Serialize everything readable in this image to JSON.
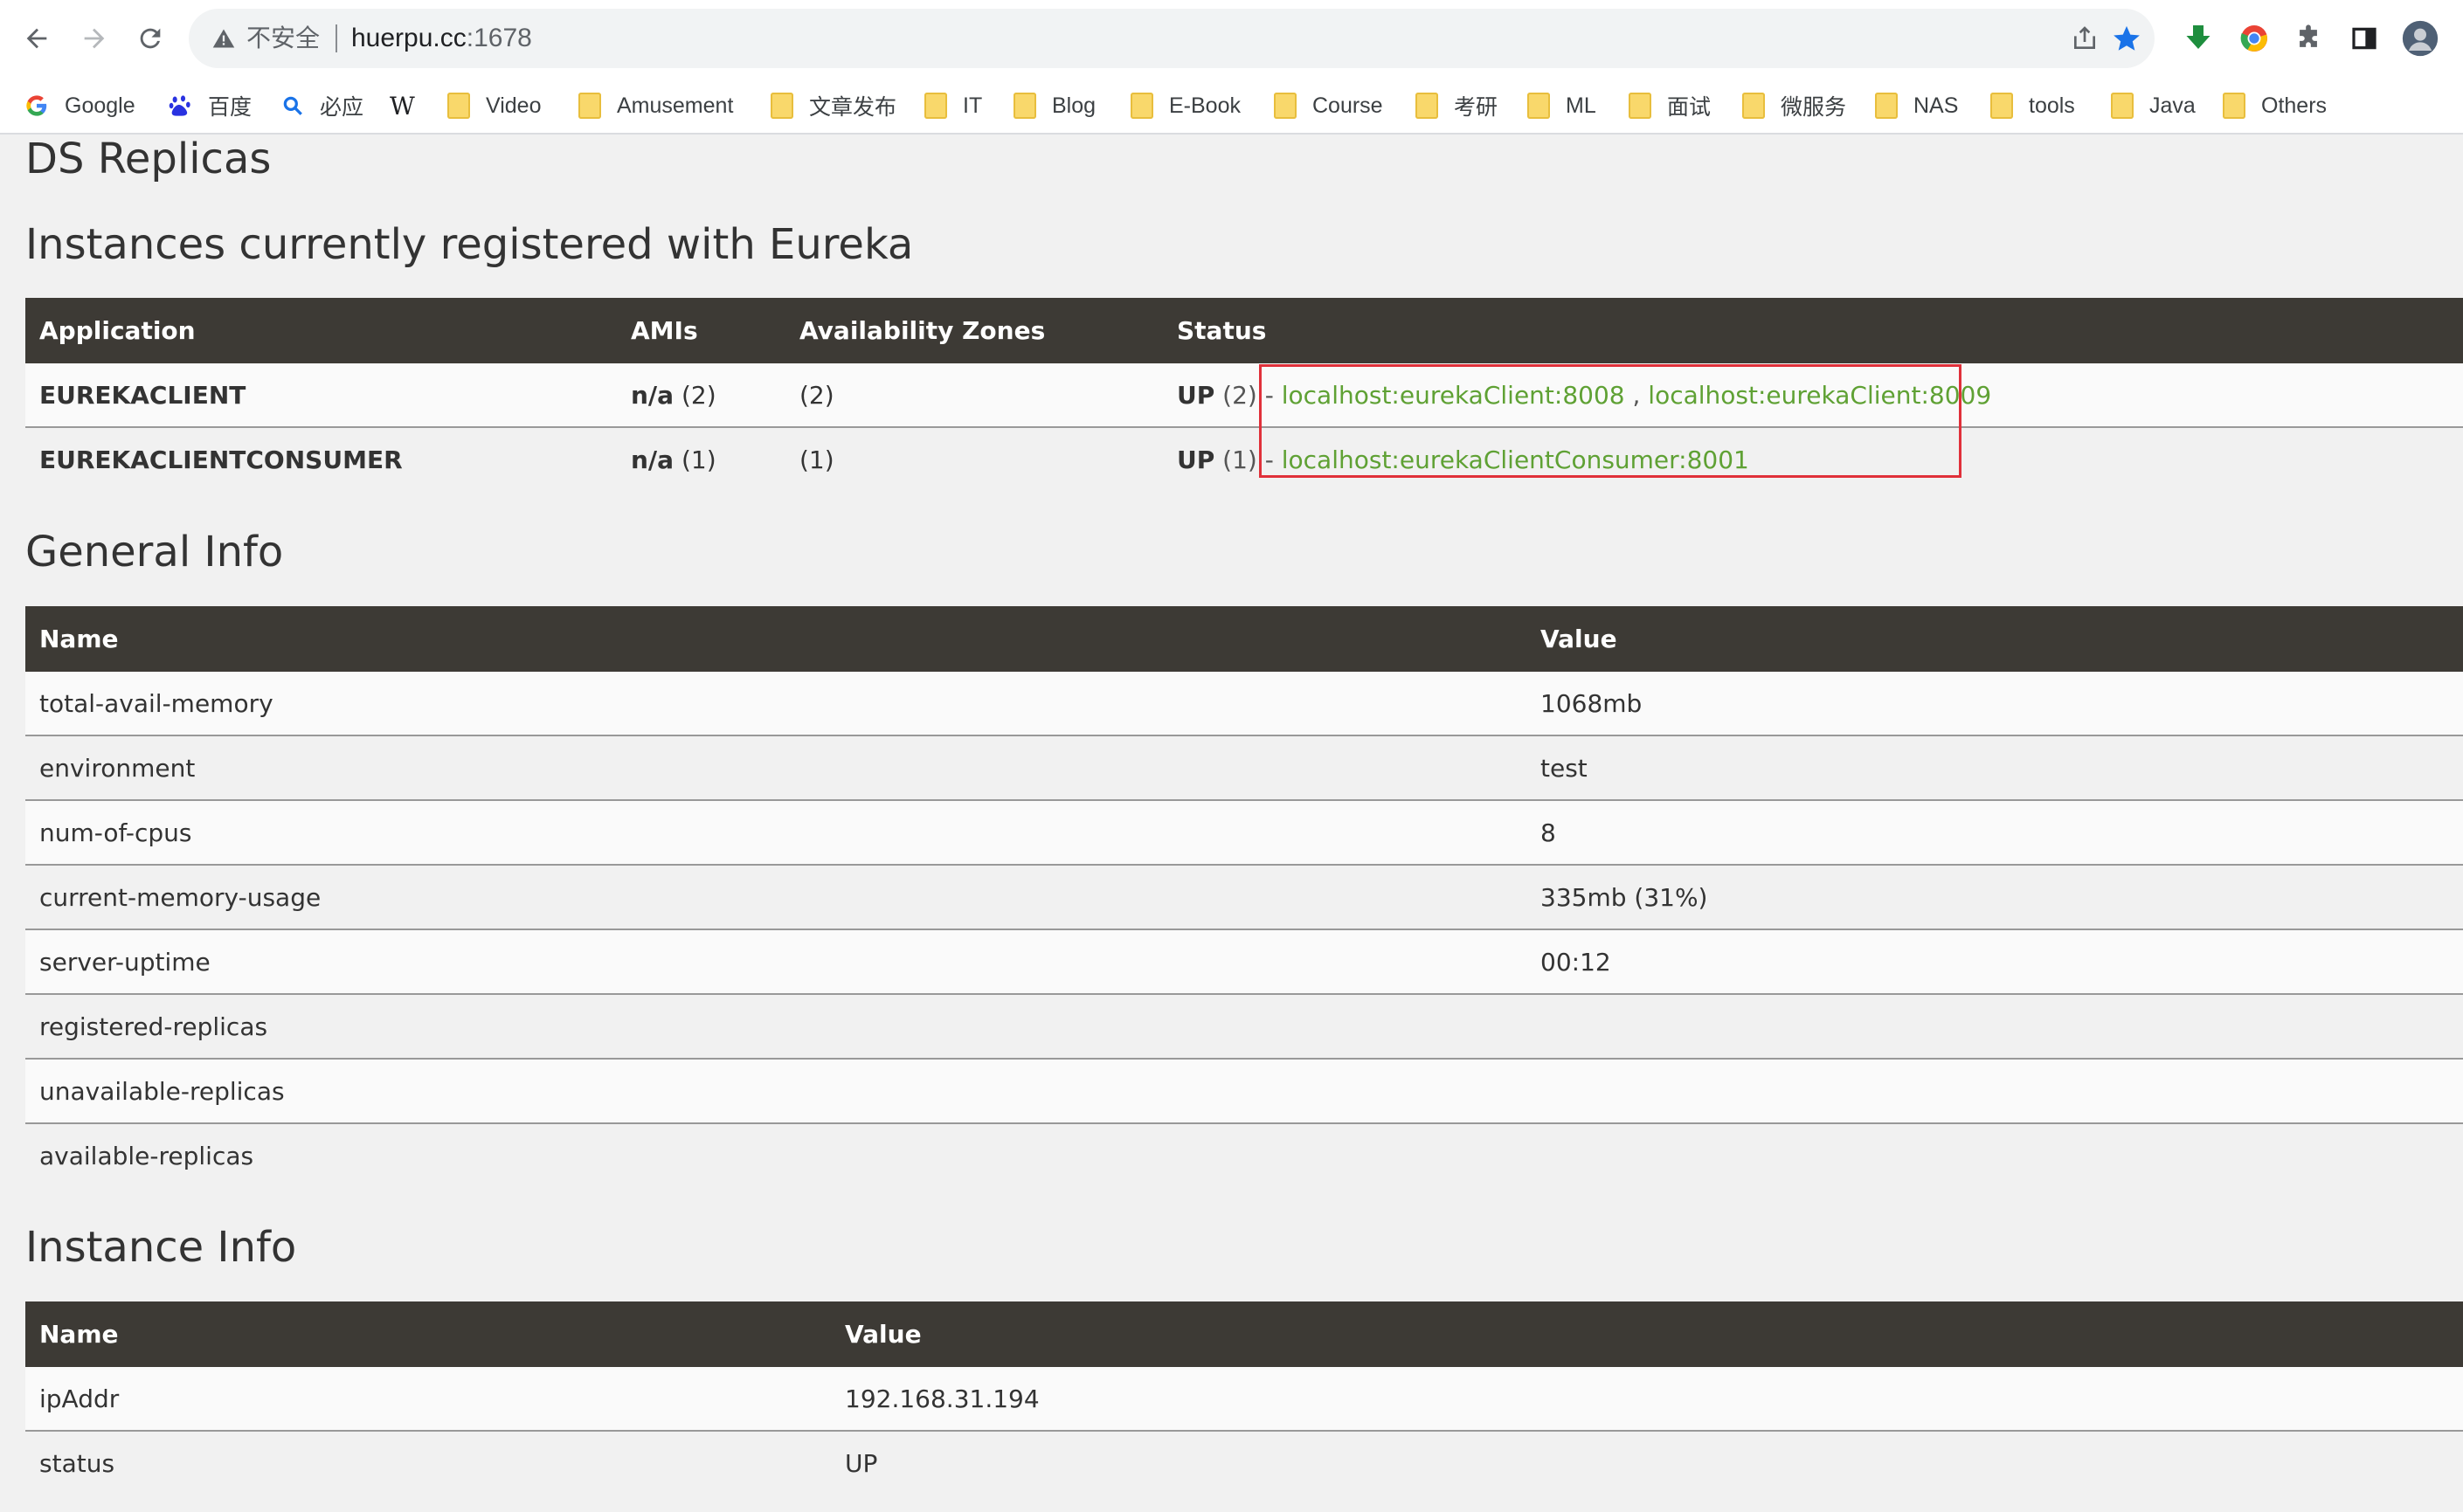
{
  "browser": {
    "insecure_label": "不安全",
    "url_host": "huerpu.cc",
    "url_port": ":1678",
    "bookmarks": [
      {
        "label": "Google",
        "icon": "google-icon"
      },
      {
        "label": "百度",
        "icon": "baidu-icon"
      },
      {
        "label": "必应",
        "icon": "bing-icon"
      },
      {
        "label": "",
        "icon": "wikipedia-icon"
      },
      {
        "label": "Video",
        "icon": "folder-icon"
      },
      {
        "label": "Amusement",
        "icon": "folder-icon"
      },
      {
        "label": "文章发布",
        "icon": "folder-icon"
      },
      {
        "label": "IT",
        "icon": "folder-icon"
      },
      {
        "label": "Blog",
        "icon": "folder-icon"
      },
      {
        "label": "E-Book",
        "icon": "folder-icon"
      },
      {
        "label": "Course",
        "icon": "folder-icon"
      },
      {
        "label": "考研",
        "icon": "folder-icon"
      },
      {
        "label": "ML",
        "icon": "folder-icon"
      },
      {
        "label": "面试",
        "icon": "folder-icon"
      },
      {
        "label": "微服务",
        "icon": "folder-icon"
      },
      {
        "label": "NAS",
        "icon": "folder-icon"
      },
      {
        "label": "tools",
        "icon": "folder-icon"
      },
      {
        "label": "Java",
        "icon": "folder-icon"
      },
      {
        "label": "Others",
        "icon": "folder-icon"
      }
    ],
    "wiki_glyph": "W"
  },
  "page": {
    "ds_replicas_title": "DS Replicas",
    "instances_title": "Instances currently registered with Eureka",
    "instances_table": {
      "headers": [
        "Application",
        "AMIs",
        "Availability Zones",
        "Status"
      ],
      "rows": [
        {
          "application": "EUREKACLIENT",
          "amis_bold": "n/a",
          "amis_count": " (2)",
          "zones": "(2)",
          "status_bold": "UP",
          "status_count": " (2) - ",
          "links": [
            "localhost:eurekaClient:8008",
            "localhost:eurekaClient:8009"
          ],
          "link_separator": " , "
        },
        {
          "application": "EUREKACLIENTCONSUMER",
          "amis_bold": "n/a",
          "amis_count": " (1)",
          "zones": "(1)",
          "status_bold": "UP",
          "status_count": " (1) - ",
          "links": [
            "localhost:eurekaClientConsumer:8001"
          ]
        }
      ]
    },
    "general_title": "General Info",
    "general_table": {
      "headers": [
        "Name",
        "Value"
      ],
      "rows": [
        {
          "name": "total-avail-memory",
          "value": "1068mb"
        },
        {
          "name": "environment",
          "value": "test"
        },
        {
          "name": "num-of-cpus",
          "value": "8"
        },
        {
          "name": "current-memory-usage",
          "value": "335mb (31%)"
        },
        {
          "name": "server-uptime",
          "value": "00:12"
        },
        {
          "name": "registered-replicas",
          "value": ""
        },
        {
          "name": "unavailable-replicas",
          "value": ""
        },
        {
          "name": "available-replicas",
          "value": ""
        }
      ]
    },
    "instance_title": "Instance Info",
    "instance_table": {
      "headers": [
        "Name",
        "Value"
      ],
      "rows": [
        {
          "name": "ipAddr",
          "value": "192.168.31.194"
        },
        {
          "name": "status",
          "value": "UP"
        }
      ]
    }
  },
  "colors": {
    "table_header_bg": "#3d3a35",
    "link_green": "#5fa134",
    "highlight_red": "#e0303a",
    "star_blue": "#1a73e8"
  }
}
